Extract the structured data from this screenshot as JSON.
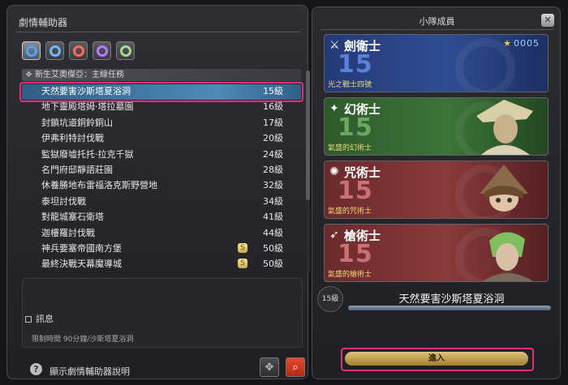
{
  "left_panel": {
    "title": "劇情輔助器",
    "job_tabs": [
      {
        "name": "tank-icon",
        "color": "#4da3ff"
      },
      {
        "name": "tank2-icon",
        "color": "#6fb9ff"
      },
      {
        "name": "melee-icon",
        "color": "#ff6a5a"
      },
      {
        "name": "caster-icon",
        "color": "#b67cff"
      },
      {
        "name": "healer-icon",
        "color": "#a7d98e"
      }
    ],
    "category": "新生艾奧傑亞：主線任務",
    "duties": [
      {
        "name": "天然要害沙斯塔夏浴洞",
        "level": "15級",
        "tomestone": false
      },
      {
        "name": "地下靈殿塔姆·塔拉墓園",
        "level": "16級",
        "tomestone": false
      },
      {
        "name": "封鎖坑道銅鈴銅山",
        "level": "17級",
        "tomestone": false
      },
      {
        "name": "伊弗利特討伐戰",
        "level": "20級",
        "tomestone": false
      },
      {
        "name": "監獄廢墟托托·拉克千獄",
        "level": "24級",
        "tomestone": false
      },
      {
        "name": "名門府邸靜語莊園",
        "level": "28級",
        "tomestone": false
      },
      {
        "name": "休養勝地布雷福洛克斯野營地",
        "level": "32級",
        "tomestone": false
      },
      {
        "name": "泰坦討伐戰",
        "level": "34級",
        "tomestone": false
      },
      {
        "name": "對龍城塞石衛塔",
        "level": "41級",
        "tomestone": false
      },
      {
        "name": "迦樓羅討伐戰",
        "level": "44級",
        "tomestone": false
      },
      {
        "name": "神兵要塞帝國南方堡",
        "level": "50級",
        "tomestone": true
      },
      {
        "name": "最終決戰天幕魔導城",
        "level": "50級",
        "tomestone": true
      }
    ],
    "info_title": "訊息",
    "info_text": "限制時間 90分鐘/沙斯塔夏浴洞",
    "help_label": "顯示劇情輔助器說明",
    "tomestone_glyph": "S"
  },
  "right_panel": {
    "title": "小隊成員",
    "close_glyph": "✕",
    "members": [
      {
        "job": "劍衛士",
        "level": "15",
        "name": "光之戰士四號",
        "icon": "⚔",
        "reward_star": "★",
        "reward": "0005"
      },
      {
        "job": "幻術士",
        "level": "15",
        "name": "氣盛的幻術士",
        "icon": "✦"
      },
      {
        "job": "咒術士",
        "level": "15",
        "name": "氣盛的咒術士",
        "icon": "✺"
      },
      {
        "job": "槍術士",
        "level": "15",
        "name": "氣盛的槍術士",
        "icon": "➶"
      }
    ],
    "duty_level": "15級",
    "duty_name": "天然要害沙斯塔夏浴洞",
    "join_label": "進入"
  }
}
